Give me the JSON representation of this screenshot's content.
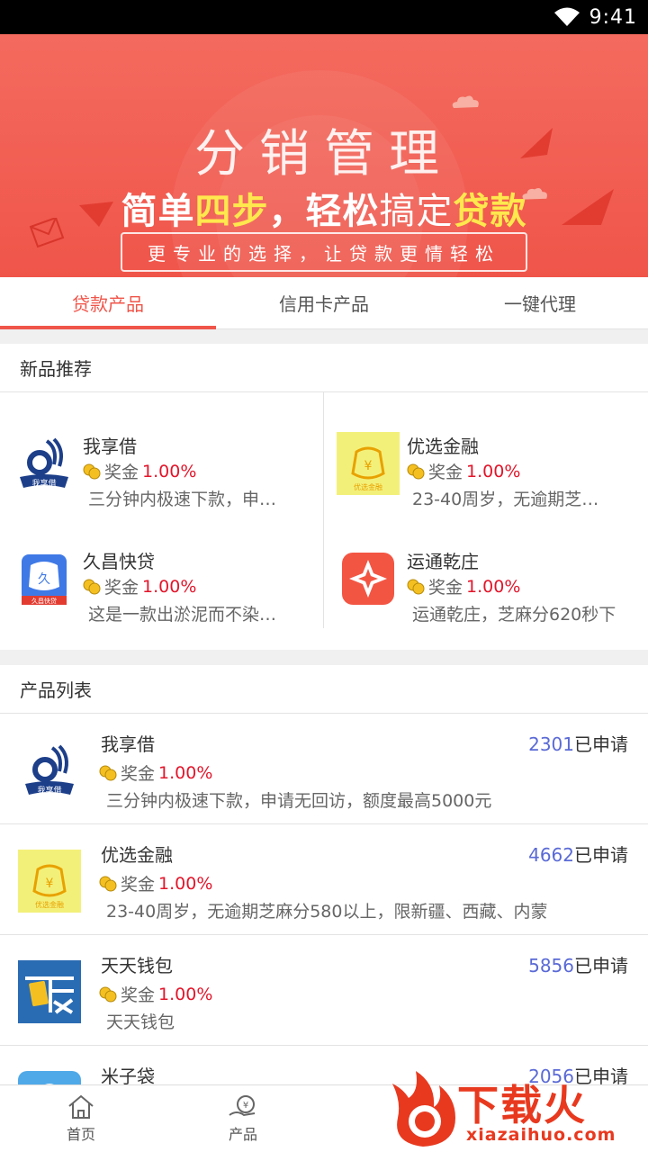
{
  "status_bar": {
    "time": "9:41"
  },
  "banner": {
    "title": "分销管理",
    "slogan": {
      "p1": "简单",
      "p2": "四步",
      "p3": "，",
      "p4": "轻松",
      "p5": "搞定",
      "p6": "贷款"
    },
    "tagline": "更专业的选择，让贷款更情轻松",
    "colors": {
      "background": "#f0554a",
      "highlight": "#ffe84d"
    }
  },
  "tabs": [
    {
      "label": "贷款产品",
      "active": true
    },
    {
      "label": "信用卡产品",
      "active": false
    },
    {
      "label": "一键代理",
      "active": false
    }
  ],
  "new_products": {
    "header": "新品推荐",
    "items": [
      {
        "name": "我享借",
        "bonus_label": "奖金",
        "bonus_rate": "1.00%",
        "desc": "三分钟内极速下款，申…",
        "logo": "woxiangjie-logo",
        "logo_text": "我享借"
      },
      {
        "name": "优选金融",
        "bonus_label": "奖金",
        "bonus_rate": "1.00%",
        "desc": "23-40周岁，无逾期芝…",
        "logo": "youxuan-logo",
        "logo_text": "优选金融"
      },
      {
        "name": "久昌快贷",
        "bonus_label": "奖金",
        "bonus_rate": "1.00%",
        "desc": "这是一款出淤泥而不染…",
        "logo": "jiuchang-logo",
        "logo_text": "久昌快贷"
      },
      {
        "name": "运通乾庄",
        "bonus_label": "奖金",
        "bonus_rate": "1.00%",
        "desc": "运通乾庄，芝麻分620秒下",
        "logo": "yuntong-logo"
      }
    ]
  },
  "product_list": {
    "header": "产品列表",
    "applied_suffix": "已申请",
    "items": [
      {
        "name": "我享借",
        "applied_count": "2301",
        "bonus_label": "奖金",
        "bonus_rate": "1.00%",
        "desc": "三分钟内极速下款，申请无回访，额度最高5000元",
        "logo": "woxiangjie-logo",
        "logo_text": "我享借"
      },
      {
        "name": "优选金融",
        "applied_count": "4662",
        "bonus_label": "奖金",
        "bonus_rate": "1.00%",
        "desc": "23-40周岁，无逾期芝麻分580以上，限新疆、西藏、内蒙",
        "logo": "youxuan-logo",
        "logo_text": "优选金融"
      },
      {
        "name": "天天钱包",
        "applied_count": "5856",
        "bonus_label": "奖金",
        "bonus_rate": "1.00%",
        "desc": "天天钱包",
        "logo": "tiantian-logo"
      },
      {
        "name": "米子袋",
        "applied_count": "2056",
        "bonus_label": "",
        "bonus_rate": "",
        "desc": "",
        "logo": "mizidai-logo"
      }
    ]
  },
  "bottom_nav": [
    {
      "label": "首页",
      "icon": "home-icon"
    },
    {
      "label": "产品",
      "icon": "product-icon"
    }
  ],
  "watermark": {
    "text": "下载火",
    "url": "xiazaihuo.com"
  },
  "colors": {
    "accent": "#f0554a",
    "rate": "#e3152a",
    "count": "#5a6ad6"
  }
}
